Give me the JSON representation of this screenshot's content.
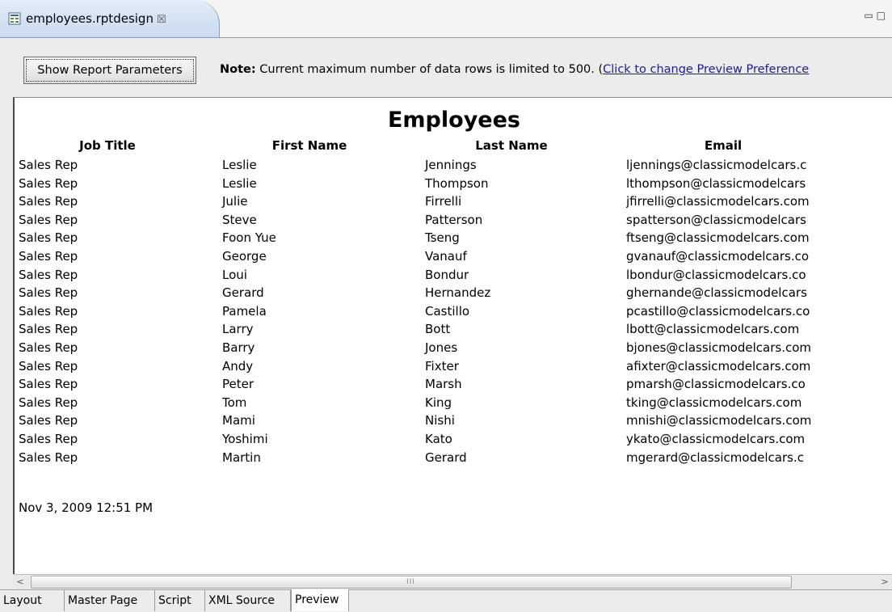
{
  "editor_tab": {
    "title": "employees.rptdesign",
    "close_glyph": "☒",
    "icon": "report-design-icon"
  },
  "window_controls": {
    "minimize": "▭",
    "maximize": "□"
  },
  "toolbar": {
    "param_button_label": "Show Report Parameters",
    "note_label": "Note:",
    "note_text": " Current maximum number of data rows is limited to 500. (",
    "note_link": "Click to change Preview Preference"
  },
  "report": {
    "title": "Employees",
    "columns": [
      "Job Title",
      "First Name",
      "Last Name",
      "Email"
    ],
    "rows": [
      [
        "Sales Rep",
        "Leslie",
        "Jennings",
        "ljennings@classicmodelcars.c"
      ],
      [
        "Sales Rep",
        "Leslie",
        "Thompson",
        "lthompson@classicmodelcars"
      ],
      [
        "Sales Rep",
        "Julie",
        "Firrelli",
        "jfirrelli@classicmodelcars.com"
      ],
      [
        "Sales Rep",
        "Steve",
        "Patterson",
        "spatterson@classicmodelcars"
      ],
      [
        "Sales Rep",
        "Foon Yue",
        "Tseng",
        "ftseng@classicmodelcars.com"
      ],
      [
        "Sales Rep",
        "George",
        "Vanauf",
        "gvanauf@classicmodelcars.co"
      ],
      [
        "Sales Rep",
        "Loui",
        "Bondur",
        "lbondur@classicmodelcars.co"
      ],
      [
        "Sales Rep",
        "Gerard",
        "Hernandez",
        "ghernande@classicmodelcars"
      ],
      [
        "Sales Rep",
        "Pamela",
        "Castillo",
        "pcastillo@classicmodelcars.co"
      ],
      [
        "Sales Rep",
        "Larry",
        "Bott",
        "lbott@classicmodelcars.com"
      ],
      [
        "Sales Rep",
        "Barry",
        "Jones",
        "bjones@classicmodelcars.com"
      ],
      [
        "Sales Rep",
        "Andy",
        "Fixter",
        "afixter@classicmodelcars.com"
      ],
      [
        "Sales Rep",
        "Peter",
        "Marsh",
        "pmarsh@classicmodelcars.co"
      ],
      [
        "Sales Rep",
        "Tom",
        "King",
        "tking@classicmodelcars.com"
      ],
      [
        "Sales Rep",
        "Mami",
        "Nishi",
        "mnishi@classicmodelcars.com"
      ],
      [
        "Sales Rep",
        "Yoshimi",
        "Kato",
        "ykato@classicmodelcars.com"
      ],
      [
        "Sales Rep",
        "Martin",
        "Gerard",
        "mgerard@classicmodelcars.c"
      ]
    ],
    "footer_date": "Nov 3, 2009 12:51 PM"
  },
  "scrollbar": {
    "left_arrow": "<",
    "right_arrow": ">",
    "grip": "III"
  },
  "bottom_tabs": [
    {
      "label": "Layout",
      "active": false
    },
    {
      "label": "Master Page",
      "active": false
    },
    {
      "label": "Script",
      "active": false
    },
    {
      "label": "XML Source",
      "active": false
    },
    {
      "label": "Preview",
      "active": true
    }
  ],
  "colors": {
    "link": "#1a1aa6",
    "tab_active": "#c9daf0",
    "preview_bg": "#ffffff"
  }
}
